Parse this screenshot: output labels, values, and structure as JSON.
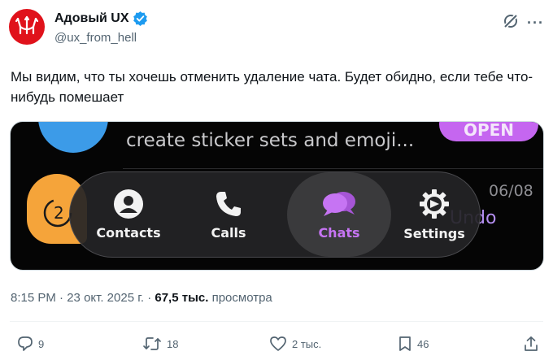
{
  "author": {
    "name": "Адовый UX",
    "handle": "@ux_from_hell",
    "verified": true,
    "avatar_icon": "trident-icon",
    "avatar_color": "#e0121b"
  },
  "tweet": {
    "text": "Мы видим, что ты хочешь отменить удаление чата. Будет обидно, если тебе что-нибудь помешает"
  },
  "media": {
    "line_text": "create sticker sets and emoji...",
    "open_button": "OPEN",
    "date": "06/08",
    "undo_text": "Undo",
    "timer_digit": "2",
    "tabs": [
      {
        "label": "Contacts",
        "icon": "person-icon"
      },
      {
        "label": "Calls",
        "icon": "phone-icon"
      },
      {
        "label": "Chats",
        "icon": "chat-bubbles-icon",
        "active": true
      },
      {
        "label": "Settings",
        "icon": "gear-icon"
      }
    ],
    "accent_color": "#c674f3"
  },
  "meta": {
    "time": "8:15 PM",
    "sep1": "·",
    "date": "23 окт. 2025 г.",
    "sep2": "·",
    "views_count": "67,5 тыс.",
    "views_label": "просмотра"
  },
  "actions": {
    "replies": "9",
    "reposts": "18",
    "likes": "2 тыс.",
    "bookmarks": "46"
  }
}
